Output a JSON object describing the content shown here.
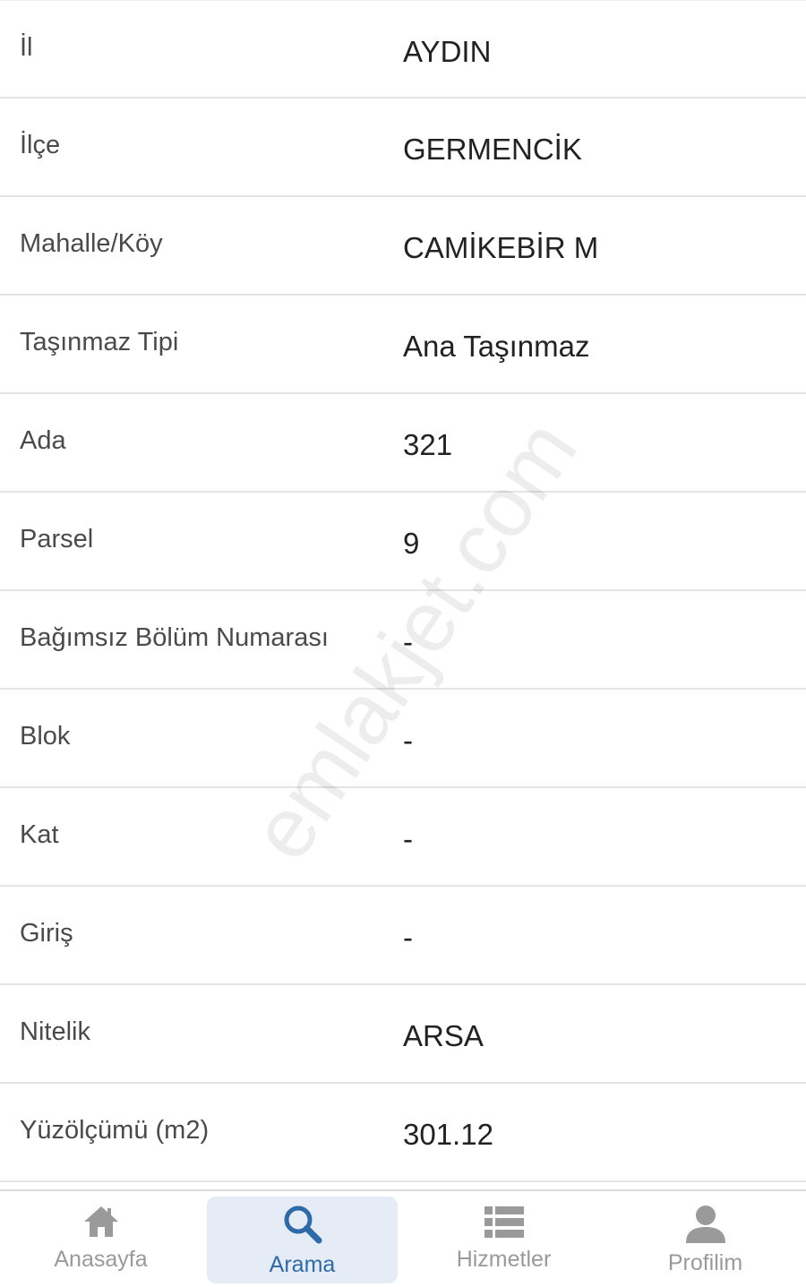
{
  "rows": [
    {
      "label": "İl",
      "value": "AYDIN"
    },
    {
      "label": "İlçe",
      "value": "GERMENCİK"
    },
    {
      "label": "Mahalle/Köy",
      "value": "CAMİKEBİR M"
    },
    {
      "label": "Taşınmaz Tipi",
      "value": "Ana Taşınmaz"
    },
    {
      "label": "Ada",
      "value": "321"
    },
    {
      "label": "Parsel",
      "value": "9"
    },
    {
      "label": "Bağımsız Bölüm Numarası",
      "value": "-"
    },
    {
      "label": "Blok",
      "value": "-"
    },
    {
      "label": "Kat",
      "value": "-"
    },
    {
      "label": "Giriş",
      "value": "-"
    },
    {
      "label": "Nitelik",
      "value": "ARSA"
    },
    {
      "label": "Yüzölçümü (m2)",
      "value": "301.12"
    }
  ],
  "watermark": "emlakjet.com",
  "tabbar": {
    "active_tab": "Arama",
    "tabs": [
      {
        "label": "Anasayfa",
        "icon": "home-icon"
      },
      {
        "label": "Arama",
        "icon": "search-icon"
      },
      {
        "label": "Hizmetler",
        "icon": "list-icon"
      },
      {
        "label": "Profilim",
        "icon": "person-icon"
      }
    ]
  },
  "colors": {
    "active": "#2d6aa8",
    "inactive": "#9a9a9a",
    "active_bg": "#e6ecf6"
  }
}
